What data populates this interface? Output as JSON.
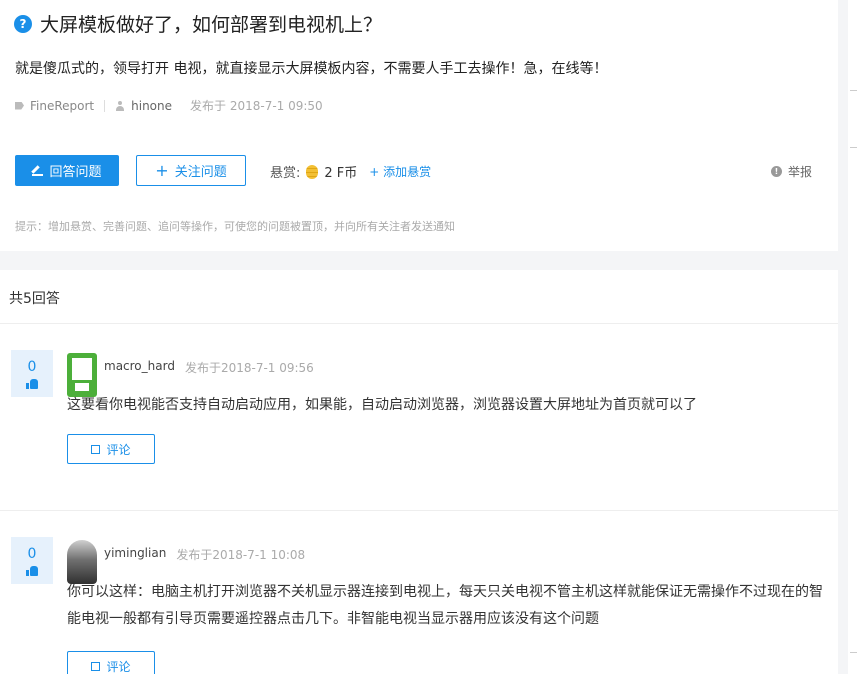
{
  "question": {
    "icon": "question-icon",
    "title": "大屏模板做好了，如何部署到电视机上？",
    "body": "就是傻瓜式的，领导打开 电视，就直接显示大屏模板内容，不需要人手工去操作！急，在线等！",
    "tag": "FineReport",
    "author": "hinone",
    "time": "发布于 2018-7-1 09:50",
    "answer_button": "回答问题",
    "follow_button": "关注问题",
    "reward_label": "悬赏:",
    "reward_value": "2 F币",
    "add_reward": "+ 添加悬赏",
    "report": "举报",
    "hint": "提示：增加悬赏、完善问题、追问等操作，可使您的问题被置顶，并向所有关注者发送通知"
  },
  "answers_header": "共5回答",
  "answers": [
    {
      "votes": "0",
      "user": "macro_hard",
      "time": "发布于2018-7-1 09:56",
      "text": "这要看你电视能否支持自动启动应用，如果能，自动启动浏览器，浏览器设置大屏地址为首页就可以了",
      "comment_button": "评论"
    },
    {
      "votes": "0",
      "user": "yiminglian",
      "time": "发布于2018-7-1 10:08",
      "text": "你可以这样：电脑主机打开浏览器不关机显示器连接到电视上，每天只关电视不管主机这样就能保证无需操作不过现在的智能电视一般都有引导页需要遥控器点击几下。非智能电视当显示器用应该没有这个问题",
      "comment_button": "评论"
    }
  ],
  "colors": {
    "accent": "#1a8fe8",
    "vote_bg": "#e6f1fc",
    "coin": "#f3c034"
  }
}
